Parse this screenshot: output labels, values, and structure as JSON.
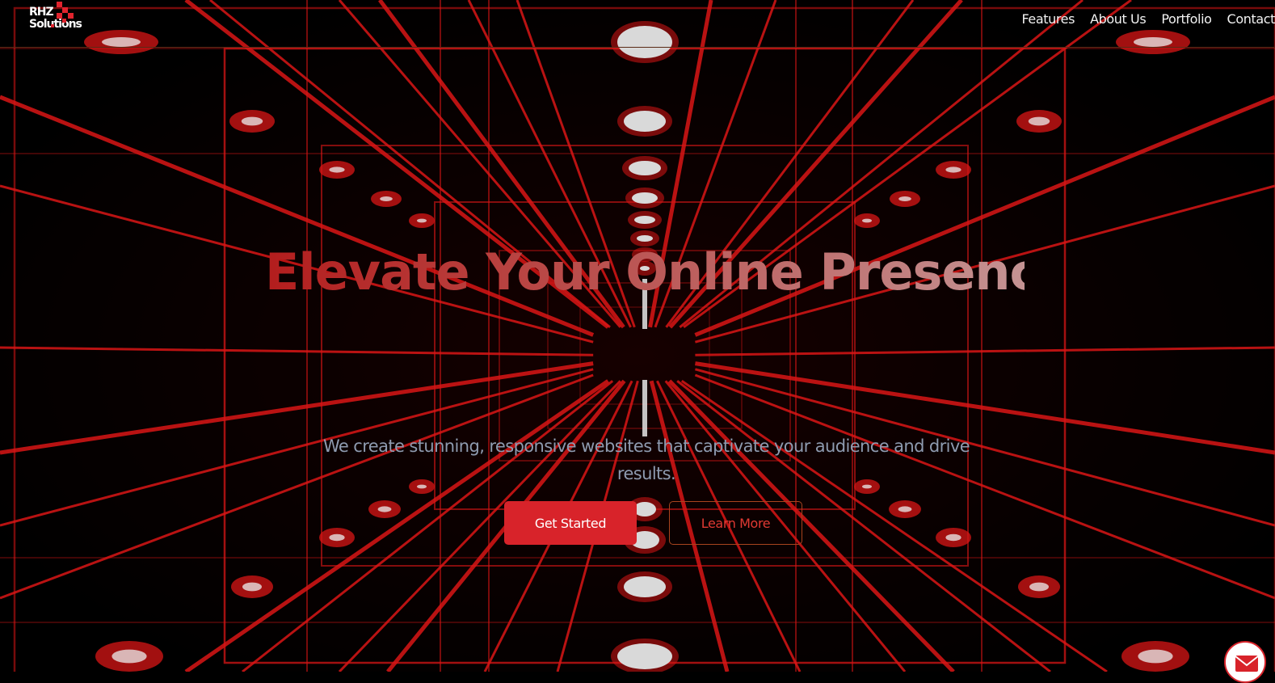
{
  "header": {
    "logo_line1": "RHZ",
    "logo_line2": "Solutions",
    "nav": [
      "Features",
      "About Us",
      "Portfolio",
      "Contact"
    ]
  },
  "hero": {
    "headline": "Elevate Your Online Presence",
    "subtext": "We create stunning, responsive websites that captivate your audience and drive results.",
    "primary_button": "Get Started",
    "secondary_button": "Learn More"
  },
  "floating": {
    "mail_icon": "mail-icon"
  },
  "colors": {
    "accent": "#d8232a",
    "background": "#000000",
    "neon": "#ff1a1a",
    "subtext": "#8e9bb0"
  }
}
